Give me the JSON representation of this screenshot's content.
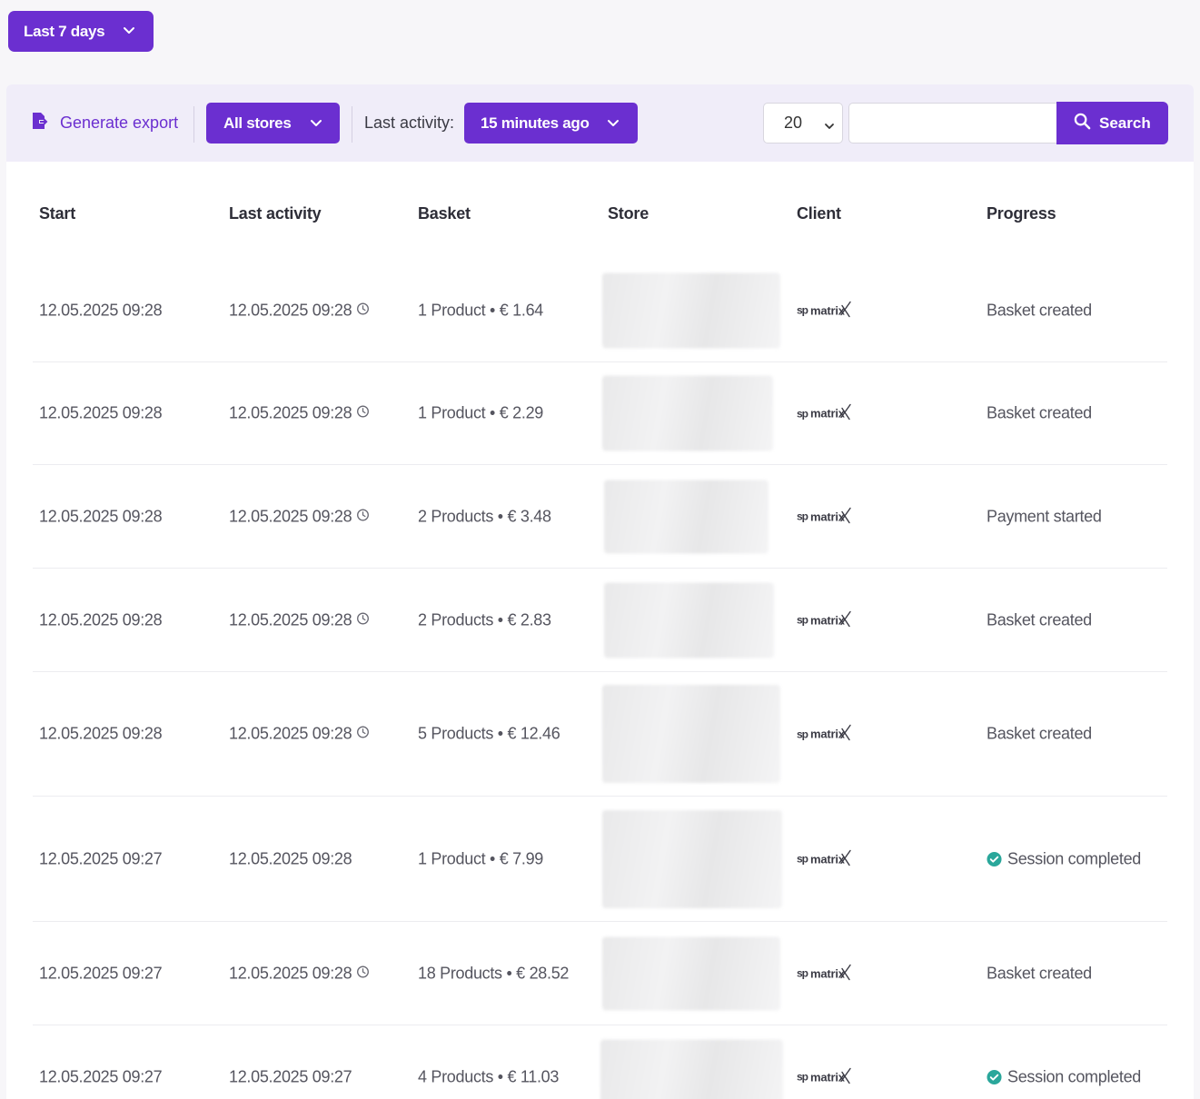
{
  "date_range": {
    "label": "Last 7 days"
  },
  "toolbar": {
    "export_label": "Generate export",
    "stores_label": "All stores",
    "activity_label": "Last activity:",
    "activity_value": "15 minutes ago",
    "page_size": "20",
    "search_placeholder": "",
    "search_label": "Search"
  },
  "table": {
    "headers": {
      "start": "Start",
      "last_activity": "Last activity",
      "basket": "Basket",
      "store": "Store",
      "client": "Client",
      "progress": "Progress"
    },
    "client_logo": {
      "prefix": "sp",
      "name": "matrix"
    },
    "rows": [
      {
        "start": "12.05.2025 09:28",
        "last_activity": "12.05.2025 09:28",
        "active": true,
        "basket": "1 Product • € 1.64",
        "progress": "Basket created",
        "completed": false
      },
      {
        "start": "12.05.2025 09:28",
        "last_activity": "12.05.2025 09:28",
        "active": true,
        "basket": "1 Product • € 2.29",
        "progress": "Basket created",
        "completed": false
      },
      {
        "start": "12.05.2025 09:28",
        "last_activity": "12.05.2025 09:28",
        "active": true,
        "basket": "2 Products • € 3.48",
        "progress": "Payment started",
        "completed": false
      },
      {
        "start": "12.05.2025 09:28",
        "last_activity": "12.05.2025 09:28",
        "active": true,
        "basket": "2 Products • € 2.83",
        "progress": "Basket created",
        "completed": false
      },
      {
        "start": "12.05.2025 09:28",
        "last_activity": "12.05.2025 09:28",
        "active": true,
        "basket": "5 Products • € 12.46",
        "progress": "Basket created",
        "completed": false
      },
      {
        "start": "12.05.2025 09:27",
        "last_activity": "12.05.2025 09:28",
        "active": false,
        "basket": "1 Product • € 7.99",
        "progress": "Session completed",
        "completed": true
      },
      {
        "start": "12.05.2025 09:27",
        "last_activity": "12.05.2025 09:28",
        "active": true,
        "basket": "18 Products • € 28.52",
        "progress": "Basket created",
        "completed": false
      },
      {
        "start": "12.05.2025 09:27",
        "last_activity": "12.05.2025 09:27",
        "active": false,
        "basket": "4 Products • € 11.03",
        "progress": "Session completed",
        "completed": true
      }
    ]
  },
  "colors": {
    "accent": "#6b2fd0",
    "success": "#2aa79b",
    "toolbar_bg": "#f0edf9"
  },
  "icons": {
    "dropdown": "chevron-down-icon",
    "export": "export-file-icon",
    "search": "search-icon",
    "clock": "clock-icon",
    "completed": "check-circle-icon"
  }
}
